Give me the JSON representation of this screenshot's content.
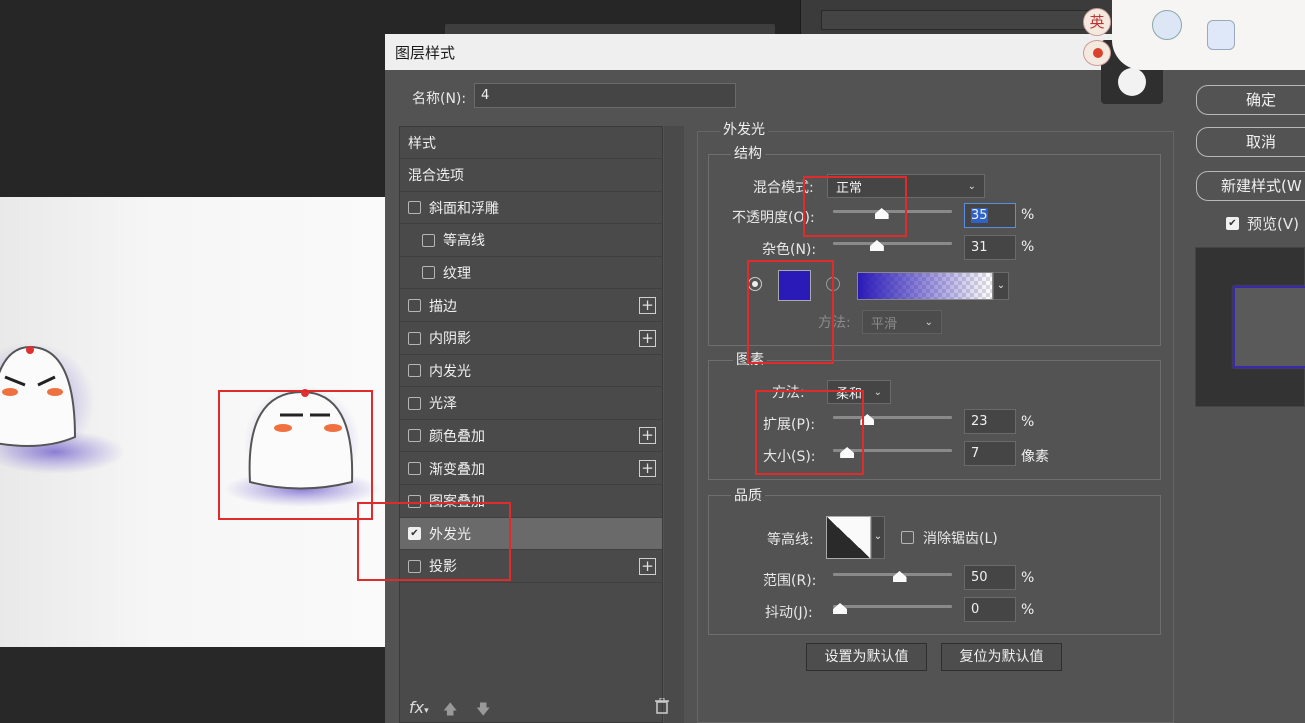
{
  "dialog": {
    "title": "图层样式",
    "name_label": "名称(N):",
    "name_value": "4"
  },
  "stylelist": {
    "items": [
      {
        "label": "样式",
        "checkbox": false,
        "plus": false,
        "indent": false,
        "checked": false
      },
      {
        "label": "混合选项",
        "checkbox": false,
        "plus": false,
        "indent": false,
        "checked": false
      },
      {
        "label": "斜面和浮雕",
        "checkbox": true,
        "plus": false,
        "indent": false,
        "checked": false
      },
      {
        "label": "等高线",
        "checkbox": true,
        "plus": false,
        "indent": true,
        "checked": false
      },
      {
        "label": "纹理",
        "checkbox": true,
        "plus": false,
        "indent": true,
        "checked": false
      },
      {
        "label": "描边",
        "checkbox": true,
        "plus": true,
        "indent": false,
        "checked": false
      },
      {
        "label": "内阴影",
        "checkbox": true,
        "plus": true,
        "indent": false,
        "checked": false
      },
      {
        "label": "内发光",
        "checkbox": true,
        "plus": false,
        "indent": false,
        "checked": false
      },
      {
        "label": "光泽",
        "checkbox": true,
        "plus": false,
        "indent": false,
        "checked": false
      },
      {
        "label": "颜色叠加",
        "checkbox": true,
        "plus": true,
        "indent": false,
        "checked": false
      },
      {
        "label": "渐变叠加",
        "checkbox": true,
        "plus": true,
        "indent": false,
        "checked": false
      },
      {
        "label": "图案叠加",
        "checkbox": true,
        "plus": false,
        "indent": false,
        "checked": false
      },
      {
        "label": "外发光",
        "checkbox": true,
        "plus": false,
        "indent": false,
        "checked": true,
        "selected": true
      },
      {
        "label": "投影",
        "checkbox": true,
        "plus": true,
        "indent": false,
        "checked": false
      }
    ],
    "footer": {
      "fx": "fx",
      "up_icon": "arrow-up-icon",
      "down_icon": "arrow-down-icon",
      "trash_icon": "trash-icon"
    }
  },
  "outer_glow": {
    "section_title": "外发光",
    "structure": {
      "title": "结构",
      "blend_mode_label": "混合模式:",
      "blend_mode_value": "正常",
      "opacity_label": "不透明度(O):",
      "opacity_value": "35",
      "opacity_fraction": 0.35,
      "noise_label": "杂色(N):",
      "noise_value": "31",
      "noise_fraction": 0.31,
      "percent": "%",
      "glow_color": "#2a1ab8",
      "method_label": "方法:",
      "method_value": "平滑"
    },
    "elements": {
      "title": "图素",
      "technique_label": "方法:",
      "technique_value": "柔和",
      "spread_label": "扩展(P):",
      "spread_value": "23",
      "spread_fraction": 0.23,
      "size_label": "大小(S):",
      "size_value": "7",
      "size_unit": "像素",
      "size_fraction": 0.06,
      "percent": "%"
    },
    "quality": {
      "title": "品质",
      "contour_label": "等高线:",
      "antialias_label": "消除锯齿(L)",
      "range_label": "范围(R):",
      "range_value": "50",
      "range_fraction": 0.5,
      "jitter_label": "抖动(J):",
      "jitter_value": "0",
      "jitter_fraction": 0,
      "percent": "%"
    },
    "buttons": {
      "make_default": "设置为默认值",
      "reset_default": "复位为默认值"
    }
  },
  "side": {
    "ok": "确定",
    "cancel": "取消",
    "new_style": "新建样式(W",
    "preview_label": "预览(V)",
    "preview_checked": true
  },
  "ime": {
    "lang_badge": "英"
  },
  "colors": {
    "accent_red": "#e02b2b",
    "dialog_bg": "#535353",
    "glow_purple": "#5a48c8"
  }
}
